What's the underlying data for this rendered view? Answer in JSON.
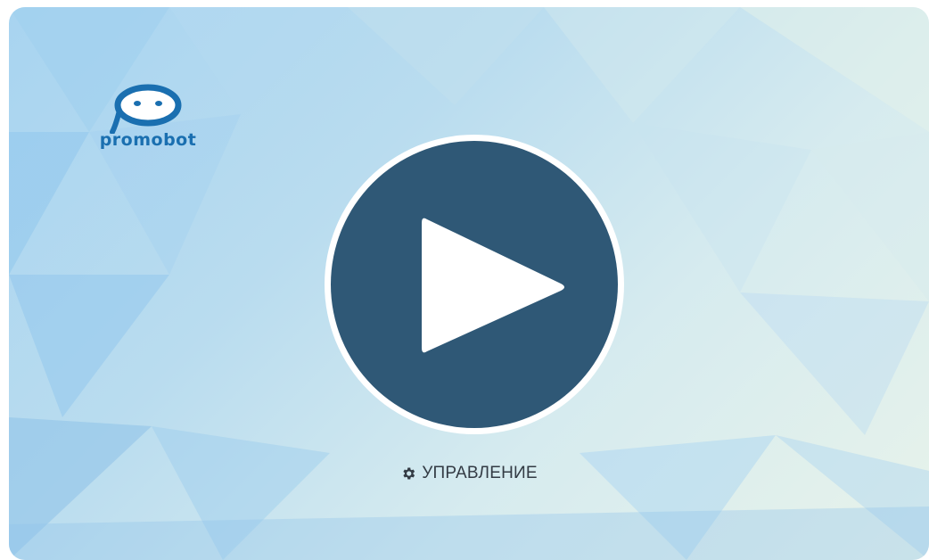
{
  "brand": {
    "logo_text": "promobot",
    "brand_color": "#1a6fb0"
  },
  "player": {
    "play_icon": "play-icon",
    "button_color": "#2f5876",
    "ring_color": "#ffffff"
  },
  "controls": {
    "label": "УПРАВЛЕНИЕ",
    "icon": "gear-icon"
  }
}
